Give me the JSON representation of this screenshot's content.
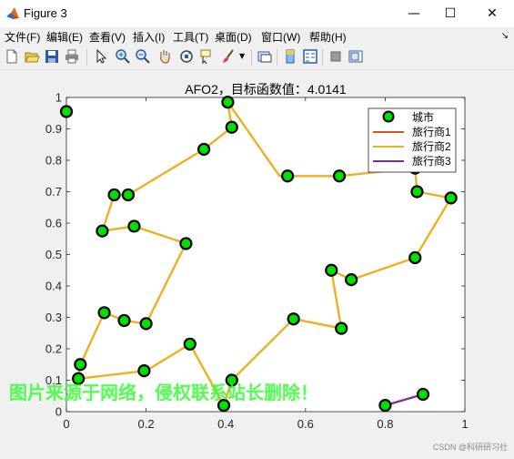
{
  "window": {
    "title": "Figure 3",
    "minimize_glyph": "—",
    "maximize_glyph": "☐",
    "close_glyph": "✕"
  },
  "menu": [
    "文件(F)",
    "编辑(E)",
    "查看(V)",
    "插入(I)",
    "工具(T)",
    "桌面(D)",
    "窗口(W)",
    "帮助(H)"
  ],
  "toolbar_icons": [
    "new-figure-icon",
    "open-file-icon",
    "save-icon",
    "print-icon",
    "pointer-icon",
    "zoom-in-icon",
    "zoom-out-icon",
    "pan-icon",
    "rotate-3d-icon",
    "data-cursor-icon",
    "brush-icon",
    "link-plot-icon",
    "insert-colorbar-icon",
    "insert-legend-icon",
    "hide-plot-tools-icon",
    "show-plot-tools-icon"
  ],
  "watermark": "图片来源于网络，侵权联系站长删除！",
  "credit": "CSDN @科研研习社",
  "colors": {
    "city": "#00e000",
    "salesman1": "#d95319",
    "salesman2": "#edb120",
    "salesman3": "#7e2f8e"
  },
  "chart_data": {
    "type": "line",
    "title": "AFO2，目标函数值：4.0141",
    "xlim": [
      0,
      1
    ],
    "ylim": [
      0,
      1
    ],
    "xticks": [
      0,
      0.2,
      0.4,
      0.6,
      0.8,
      1
    ],
    "yticks": [
      0,
      0.1,
      0.2,
      0.3,
      0.4,
      0.5,
      0.6,
      0.7,
      0.8,
      0.9,
      1
    ],
    "xtick_labels": [
      "0",
      "0.2",
      "0.4",
      "0.6",
      "0.8",
      "1"
    ],
    "ytick_labels": [
      "0",
      "0.1",
      "0.2",
      "0.3",
      "0.4",
      "0.5",
      "0.6",
      "0.7",
      "0.8",
      "0.9",
      "1"
    ],
    "legend_position": "top-right",
    "legend": [
      "城市",
      "旅行商1",
      "旅行商2",
      "旅行商3"
    ],
    "cities": [
      [
        0.0,
        0.955
      ],
      [
        0.405,
        0.985
      ],
      [
        0.415,
        0.905
      ],
      [
        0.345,
        0.835
      ],
      [
        0.155,
        0.69
      ],
      [
        0.12,
        0.69
      ],
      [
        0.09,
        0.575
      ],
      [
        0.17,
        0.59
      ],
      [
        0.3,
        0.535
      ],
      [
        0.095,
        0.315
      ],
      [
        0.145,
        0.29
      ],
      [
        0.2,
        0.28
      ],
      [
        0.31,
        0.215
      ],
      [
        0.195,
        0.13
      ],
      [
        0.035,
        0.15
      ],
      [
        0.03,
        0.105
      ],
      [
        0.395,
        0.02
      ],
      [
        0.415,
        0.1
      ],
      [
        0.57,
        0.295
      ],
      [
        0.69,
        0.265
      ],
      [
        0.665,
        0.45
      ],
      [
        0.715,
        0.42
      ],
      [
        0.875,
        0.49
      ],
      [
        0.555,
        0.75
      ],
      [
        0.685,
        0.75
      ],
      [
        0.875,
        0.775
      ],
      [
        0.88,
        0.7
      ],
      [
        0.965,
        0.68
      ],
      [
        0.8,
        0.02
      ],
      [
        0.895,
        0.055
      ]
    ],
    "series": [
      {
        "name": "旅行商1",
        "points": []
      },
      {
        "name": "旅行商2",
        "points": [
          [
            0.395,
            0.02
          ],
          [
            0.31,
            0.215
          ],
          [
            0.2,
            0.13
          ],
          [
            0.03,
            0.105
          ],
          [
            0.035,
            0.15
          ],
          [
            0.095,
            0.315
          ],
          [
            0.145,
            0.29
          ],
          [
            0.2,
            0.28
          ],
          [
            0.3,
            0.535
          ],
          [
            0.17,
            0.59
          ],
          [
            0.09,
            0.575
          ],
          [
            0.12,
            0.69
          ],
          [
            0.155,
            0.69
          ],
          [
            0.345,
            0.835
          ],
          [
            0.415,
            0.905
          ],
          [
            0.405,
            0.985
          ],
          [
            0.535,
            0.75
          ],
          [
            0.685,
            0.75
          ],
          [
            0.875,
            0.775
          ],
          [
            0.88,
            0.7
          ],
          [
            0.965,
            0.68
          ],
          [
            0.875,
            0.49
          ],
          [
            0.715,
            0.42
          ],
          [
            0.665,
            0.45
          ],
          [
            0.69,
            0.265
          ],
          [
            0.57,
            0.295
          ],
          [
            0.415,
            0.1
          ],
          [
            0.395,
            0.02
          ]
        ]
      },
      {
        "name": "旅行商3",
        "points": [
          [
            0.8,
            0.02
          ],
          [
            0.895,
            0.055
          ]
        ]
      }
    ]
  }
}
